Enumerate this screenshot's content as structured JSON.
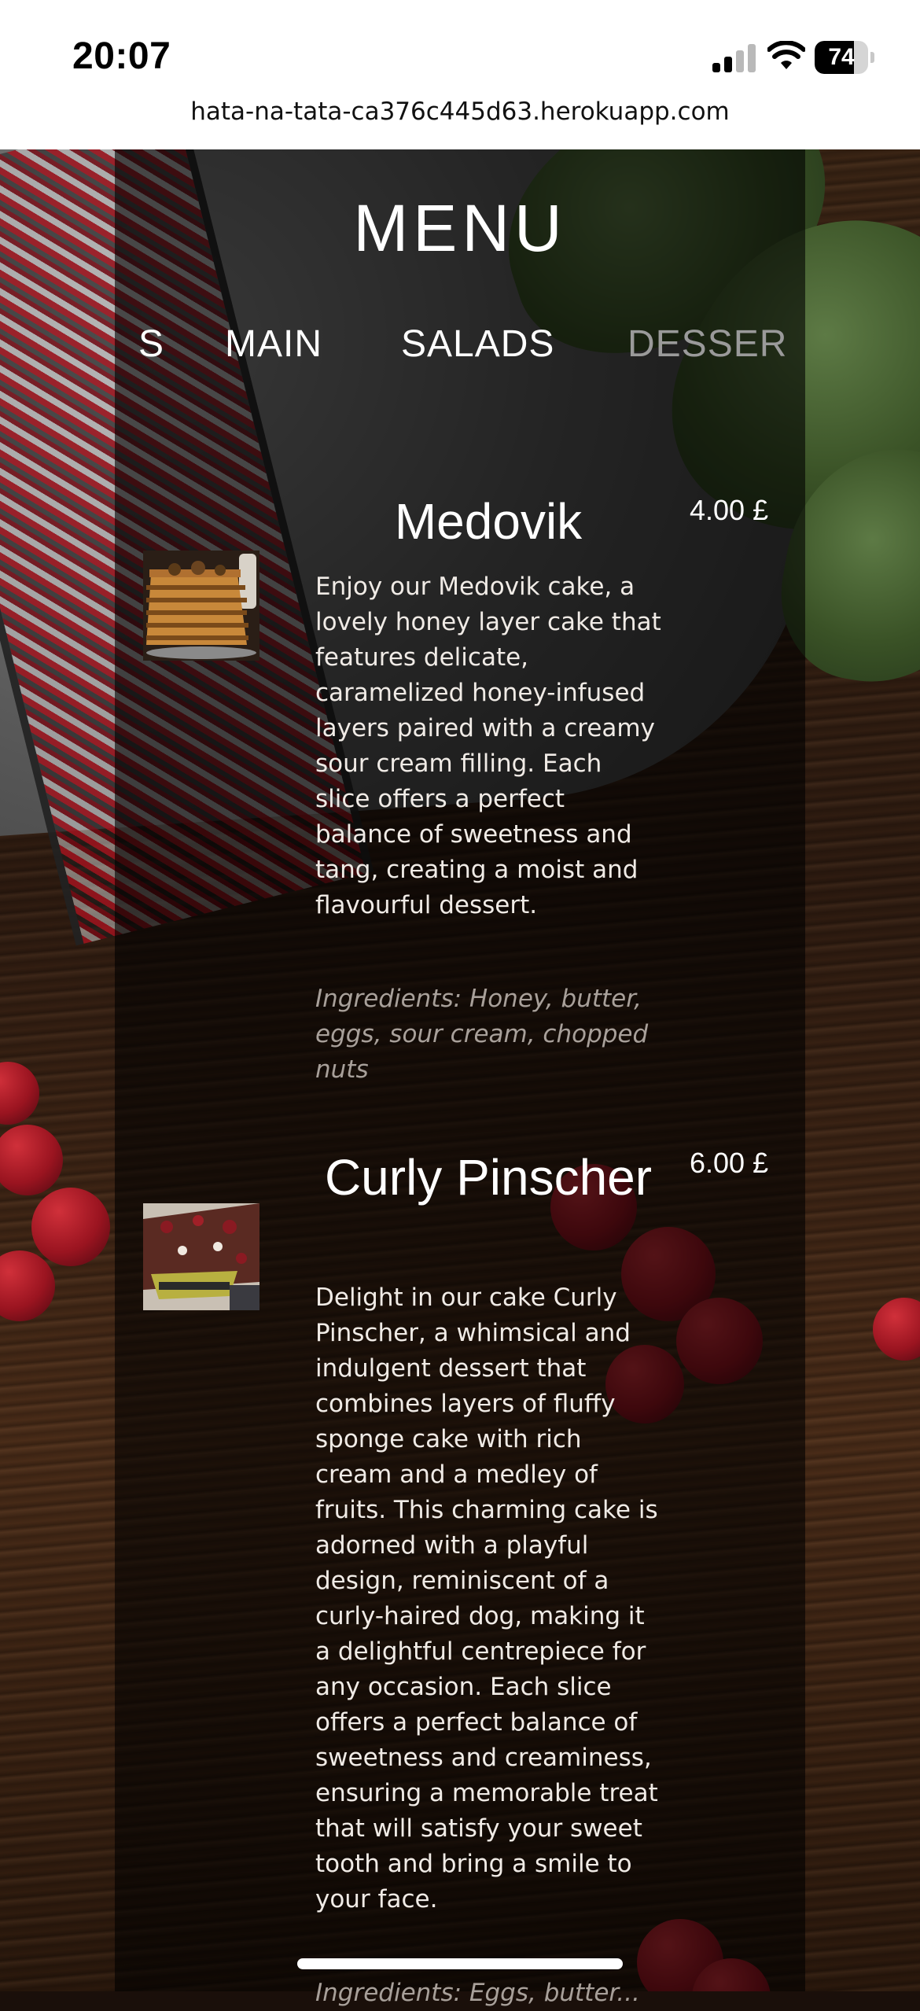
{
  "status_bar": {
    "time": "20:07",
    "battery_level": "74",
    "battery_fraction": 0.74,
    "signal_bars_active": 2,
    "signal_bars_total": 4
  },
  "browser": {
    "url": "hata-na-tata-ca376c445d63.herokuapp.com"
  },
  "menu": {
    "title": "MENU",
    "tabs": [
      {
        "label": "S",
        "active": false
      },
      {
        "label": "MAIN",
        "active": false
      },
      {
        "label": "SALADS",
        "active": false
      },
      {
        "label": "DESSER",
        "active": true
      }
    ],
    "items": [
      {
        "name": "Medovik",
        "price": "4.00 £",
        "description": "Enjoy our Medovik cake, a lovely honey layer cake that features delicate, caramelized honey-infused layers paired with a creamy sour cream filling. Each slice offers a perfect balance of sweetness and tang, creating a moist and flavourful dessert.",
        "ingredients": "Ingredients: Honey, butter, eggs, sour cream, chopped nuts",
        "image_icon": "layered-honey-cake-icon"
      },
      {
        "name": "Curly Pinscher",
        "price": "6.00 £",
        "description": "Delight in our cake Curly Pinscher, a whimsical and indulgent dessert that combines layers of fluffy sponge cake with rich cream and a medley of fruits. This charming cake is adorned with a playful design, reminiscent of a curly-haired dog, making it a delightful centrepiece for any occasion. Each slice offers a perfect balance of sweetness and creaminess, ensuring a memorable treat that will satisfy your sweet tooth and bring a smile to your face.",
        "ingredients": "Ingredients: Eggs, butter...",
        "image_icon": "chocolate-cherry-cake-icon"
      }
    ]
  },
  "colors": {
    "panel_overlay": "rgba(0,0,0,0.6)",
    "text_primary": "#ffffff",
    "text_muted": "#a8a09a",
    "tab_inactive": "#9a9a9a"
  }
}
